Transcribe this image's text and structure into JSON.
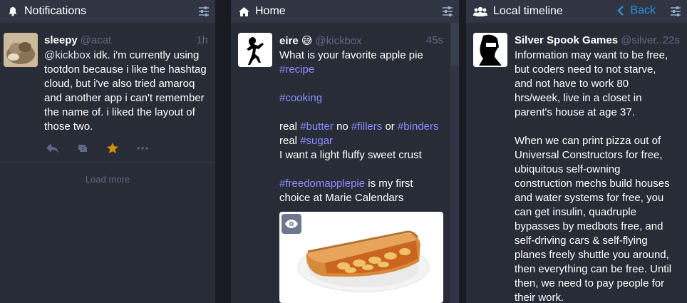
{
  "notifications": {
    "title": "Notifications",
    "icon": "bell-icon",
    "status": {
      "display_name": "sleepy",
      "acct": "@acat",
      "time": "1h",
      "mention": "@kickbox",
      "lines": [
        " idk. i'm currently using",
        "tootdon because i like the hashtag",
        "cloud, but i've also tried amaroq",
        "and another app i can't remember",
        "the name of. i liked the layout of",
        "those two."
      ]
    },
    "load_more": "Load more"
  },
  "home": {
    "title": "Home",
    "icon": "home-icon",
    "status": {
      "display_name": "eire",
      "emoji": "😅",
      "acct": "@kickbox",
      "time": "45s",
      "line1": "What is your favorite apple pie",
      "tag_recipe": "#recipe",
      "tag_cooking": "#cooking",
      "real1": "real ",
      "tag_butter": "#butter",
      "no": " no ",
      "tag_fillers": "#fillers",
      "or": " or ",
      "tag_binders": "#binders",
      "real2": "real ",
      "tag_sugar": "#sugar",
      "line_crust": "I want a light fluffy sweet crust",
      "tag_freedom": "#freedomapplepie",
      "tail1": " is my first",
      "tail2": "choice at Marie Calendars"
    }
  },
  "local": {
    "title": "Local timeline",
    "icon": "users-icon",
    "back_label": "Back",
    "status": {
      "display_name": "Silver Spook Games",
      "acct": "@silver...",
      "time": "22s",
      "para1": [
        "Information may want to be free,",
        "but coders need to not starve,",
        "and not have to work 80",
        "hrs/week, live in a closet in",
        "parent's house at age 37."
      ],
      "para2": [
        "When we can print pizza out of",
        "Universal Constructors for free,",
        "ubiquitous self-owning",
        "construction mechs build houses",
        "and water systems for free, you",
        "can get insulin, quadruple",
        "bypasses by medbots free, and",
        "self-driving cars & self-flying",
        "planes freely shuttle you around,",
        "then everything can be free. Until",
        "then, we need to pay people for",
        "their work."
      ]
    }
  },
  "colors": {
    "background": "#191b22",
    "column": "#282c37",
    "header": "#313543",
    "hashtag": "#8c8dff",
    "muted": "#606984",
    "favourite": "#ca8f04",
    "accent": "#2b90d9"
  }
}
